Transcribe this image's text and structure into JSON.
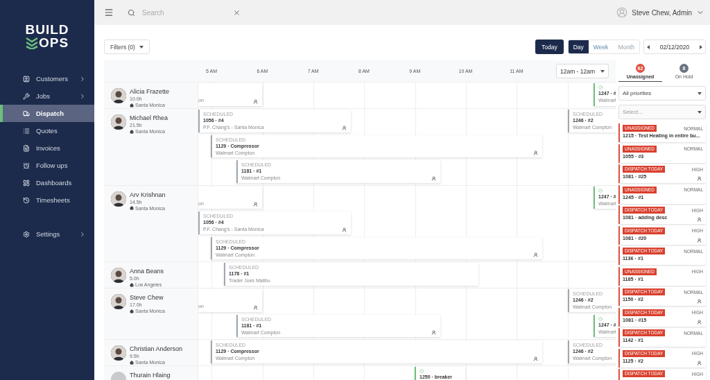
{
  "sidebar": {
    "logo": {
      "line1": "BUILD",
      "line2": "OPS"
    },
    "items": [
      {
        "label": "Customers",
        "selected": false,
        "submenu": true
      },
      {
        "label": "Jobs",
        "selected": false,
        "submenu": true
      },
      {
        "label": "Dispatch",
        "selected": true,
        "submenu": false
      },
      {
        "label": "Quotes",
        "selected": false,
        "submenu": false
      },
      {
        "label": "Invoices",
        "selected": false,
        "submenu": false
      },
      {
        "label": "Follow ups",
        "selected": false,
        "submenu": false
      },
      {
        "label": "Dashboards",
        "selected": false,
        "submenu": false
      },
      {
        "label": "Timesheets",
        "selected": false,
        "submenu": false
      }
    ],
    "bottom_items": [
      {
        "label": "Settings",
        "selected": false,
        "submenu": true
      }
    ]
  },
  "topbar": {
    "search": {
      "placeholder": "Search"
    },
    "user": "Steve Chew, Admin"
  },
  "toolbar": {
    "filters": "Filters (0)",
    "today": "Today",
    "views": [
      {
        "label": "Day",
        "selected": true,
        "disabled": false
      },
      {
        "label": "Week",
        "selected": false,
        "disabled": false
      },
      {
        "label": "Month",
        "selected": false,
        "disabled": true
      }
    ],
    "date": "02/12/2020"
  },
  "schedule": {
    "hours": [
      "5 AM",
      "6 AM",
      "7 AM",
      "8 AM",
      "9 AM",
      "10 AM",
      "11 AM"
    ],
    "range": "12am - 12am",
    "technicians": [
      {
        "name": "Alicia Frazette",
        "hours": "10.0h",
        "location": "Santa Monica",
        "has_photo": true,
        "lanes": [
          [
            {
              "kind": "clipped",
              "place": "on",
              "crew": true
            },
            {
              "kind": "completed",
              "title": "1247 · #",
              "place": "Walmart"
            }
          ]
        ]
      },
      {
        "name": "Michael Rhea",
        "hours": "21.5h",
        "location": "Santa Monica",
        "has_photo": true,
        "lanes": [
          [
            {
              "kind": "scheduled",
              "status": "SCHEDULED",
              "title": "1056 · #4",
              "place": "P.F. Chang's - Santa Monica",
              "crew": true
            },
            {
              "kind": "scheduled",
              "status": "SCHEDULED",
              "title": "1246 · #2",
              "place": "Walmart Compton",
              "crew": false
            }
          ],
          [
            {
              "kind": "scheduled",
              "status": "SCHEDULED",
              "title": "1129 · Compressor",
              "place": "Walmart Compton",
              "crew": true
            }
          ],
          [
            {
              "kind": "scheduled",
              "status": "SCHEDULED",
              "title": "1181 · #1",
              "place": "Walmart Compton",
              "crew": true
            }
          ]
        ]
      },
      {
        "name": "Arv Krishnan",
        "hours": "14.5h",
        "location": "Santa Monica",
        "has_photo": true,
        "lanes": [
          [
            {
              "kind": "clipped",
              "place": "on",
              "crew": true
            },
            {
              "kind": "completed",
              "title": "1247 · #",
              "place": "Walmart"
            }
          ],
          [
            {
              "kind": "scheduled",
              "status": "SCHEDULED",
              "title": "1056 · #4",
              "place": "P.F. Chang's - Santa Monica",
              "crew": true
            }
          ],
          [
            {
              "kind": "scheduled",
              "status": "SCHEDULED",
              "title": "1129 · Compressor",
              "place": "Walmart Compton",
              "crew": true
            }
          ]
        ]
      },
      {
        "name": "Anna Beans",
        "hours": "5.0h",
        "location": "Los Angeles",
        "has_photo": true,
        "lanes": [
          [
            {
              "kind": "scheduled",
              "status": "SCHEDULED",
              "title": "1178 · #1",
              "place": "Trader Joes Malibu",
              "crew": false
            }
          ]
        ]
      },
      {
        "name": "Steve Chew",
        "hours": "17.0h",
        "location": "Santa Monica",
        "has_photo": true,
        "lanes": [
          [
            {
              "kind": "clipped",
              "place": "on",
              "crew": true
            },
            {
              "kind": "scheduled",
              "status": "SCHEDULED",
              "title": "1246 · #2",
              "place": "Walmart Compton",
              "crew": false
            }
          ],
          [
            {
              "kind": "scheduled",
              "status": "SCHEDULED",
              "title": "1181 · #1",
              "place": "Walmart Compton",
              "crew": true
            },
            {
              "kind": "completed",
              "title": "1247 · #",
              "place": "Walmart"
            }
          ]
        ]
      },
      {
        "name": "Christian Anderson",
        "hours": "9.5h",
        "location": "Santa Monica",
        "has_photo": true,
        "lanes": [
          [
            {
              "kind": "scheduled",
              "status": "SCHEDULED",
              "title": "1129 · Compressor",
              "place": "Walmart Compton",
              "crew": true
            },
            {
              "kind": "scheduled",
              "status": "SCHEDULED",
              "title": "1246 · #2",
              "place": "Walmart Compton",
              "crew": false
            }
          ]
        ]
      },
      {
        "name": "Thurain Hlaing",
        "has_photo": false,
        "lanes": [
          [
            {
              "kind": "completed",
              "title": "1250 · breaker"
            }
          ]
        ]
      }
    ]
  },
  "queue": {
    "tabs": [
      {
        "label": "Unassigned",
        "count": "62",
        "selected": true
      },
      {
        "label": "On Hold",
        "count": "8",
        "selected": false
      }
    ],
    "priority_filter": "All priorities",
    "second_filter": {
      "placeholder": "Select..."
    },
    "jobs": [
      {
        "tag": "UNASSIGNED",
        "priority": "NORMAL",
        "title": "1215 · Test Heating in entire bu...",
        "crew": false
      },
      {
        "tag": "UNASSIGNED",
        "priority": "NORMAL",
        "title": "1055 · #3",
        "crew": false
      },
      {
        "tag": "DISPATCH TODAY",
        "priority": "HIGH",
        "title": "1081 · #25",
        "crew": true
      },
      {
        "tag": "UNASSIGNED",
        "priority": "NORMAL",
        "title": "1245 · #1",
        "crew": false
      },
      {
        "tag": "DISPATCH TODAY",
        "priority": "HIGH",
        "title": "1081 · adding desc",
        "crew": true
      },
      {
        "tag": "DISPATCH TODAY",
        "priority": "HIGH",
        "title": "1081 · #20",
        "crew": true
      },
      {
        "tag": "DISPATCH TODAY",
        "priority": "NORMAL",
        "title": "1136 · #1",
        "crew": false
      },
      {
        "tag": "UNASSIGNED",
        "priority": "HIGH",
        "title": "1185 · #1",
        "crew": false
      },
      {
        "tag": "DISPATCH TODAY",
        "priority": "NORMAL",
        "title": "1150 · #2",
        "crew": true
      },
      {
        "tag": "DISPATCH TODAY",
        "priority": "HIGH",
        "title": "1081 · #15",
        "crew": true
      },
      {
        "tag": "DISPATCH TODAY",
        "priority": "NORMAL",
        "title": "1142 · #1",
        "crew": false
      },
      {
        "tag": "DISPATCH TODAY",
        "priority": "HIGH",
        "title": "1125 · #2",
        "crew": true
      },
      {
        "tag": "DISPATCH TODAY",
        "priority": "HIGH"
      }
    ]
  }
}
